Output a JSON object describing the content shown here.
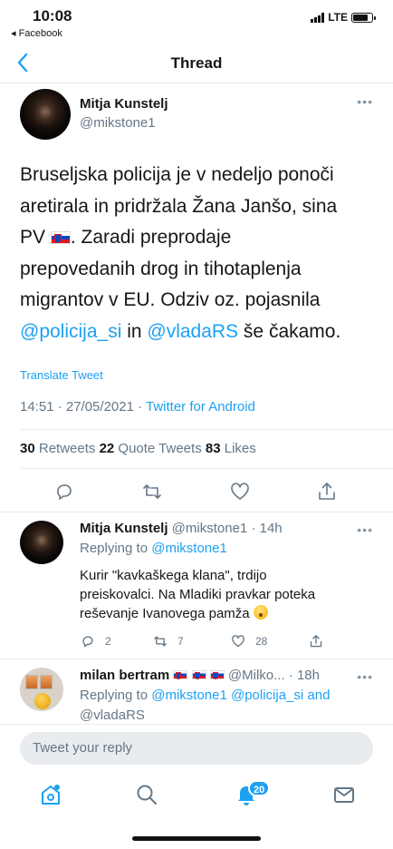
{
  "status_bar": {
    "time": "10:08",
    "back_app": "◂ Facebook",
    "network": "LTE"
  },
  "nav": {
    "title": "Thread",
    "back_icon": "chevron-left-icon"
  },
  "main_tweet": {
    "author_name": "Mitja Kunstelj",
    "author_handle": "@mikstone1",
    "text_line1": "Bruseljska policija je v nedeljo ponoči",
    "text_line2": "aretirala in pridržala Žana Janšo, sina",
    "text_line3_before_flag": "PV ",
    "text_line3_after_flag": ". Zaradi preprodaje",
    "text_line4": "prepovedanih drog in tihotaplenja",
    "text_line5": "migrantov v EU. Odziv oz. pojasnila",
    "mention_1": "@policija_si",
    "text_in": " in ",
    "mention_2": "@vladaRS",
    "text_end": " še čakamo.",
    "translate_label": "Translate Tweet",
    "timestamp": "14:51 · 27/05/2021 · ",
    "source": "Twitter for Android",
    "stats": {
      "retweets_count": "30",
      "retweets_label": " Retweets ",
      "quotes_count": "22",
      "quotes_label": " Quote Tweets ",
      "likes_count": "83",
      "likes_label": " Likes"
    }
  },
  "replies": [
    {
      "author_name": "Mitja Kunstelj",
      "author_handle": " @mikstone1 · 14h",
      "replying_prefix": "Replying to ",
      "replying_to": "@mikstone1",
      "text_line1": "Kurir \"kavkaškega klana\", trdijo",
      "text_line2": "preiskovalci. Na Mladiki pravkar poteka",
      "text_line3": "reševanje Ivanovega pamža ",
      "reply_count": "2",
      "retweet_count": "7",
      "like_count": "28"
    },
    {
      "author_name": "milan bertram",
      "author_handle": " @Milko... · 18h",
      "replying_prefix": "Replying to ",
      "replying_to": "@mikstone1 @policija_si and",
      "replying_to_cont": "@vladaRS"
    }
  ],
  "reply_bar": {
    "placeholder": "Tweet your reply"
  },
  "tabbar": {
    "notification_count": "20"
  },
  "colors": {
    "accent": "#1da1f2",
    "secondary_text": "#657786",
    "primary_text": "#14171a"
  }
}
